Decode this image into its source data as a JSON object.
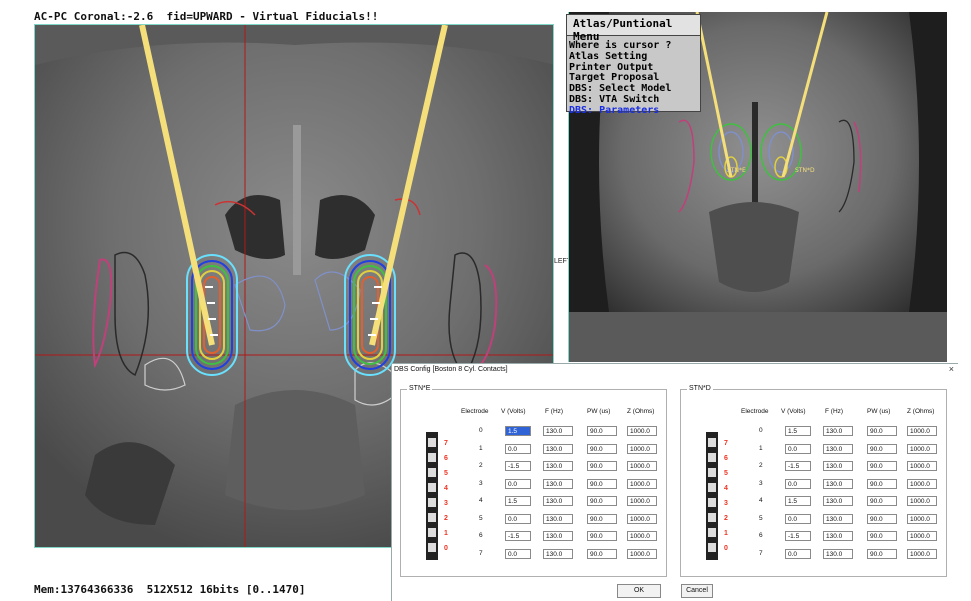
{
  "left_viewer": {
    "title": "AC-PC Coronal:-2.6  fid=UPWARD - Virtual Fiducials!!",
    "status": "Mem:13764366336  512X512 16bits [0..1470]",
    "side_label": "LEFT"
  },
  "atlas_menu": {
    "title": "Atlas/Puntional Menu",
    "items": [
      {
        "label": "Where is cursor ?",
        "active": false
      },
      {
        "label": "Atlas Setting",
        "active": false
      },
      {
        "label": "Printer Output",
        "active": false
      },
      {
        "label": "Target Proposal",
        "active": false
      },
      {
        "label": "DBS: Select Model",
        "active": false
      },
      {
        "label": "DBS: VTA Switch",
        "active": false
      },
      {
        "label": "DBS: Parameters",
        "active": true
      }
    ]
  },
  "right_viewer": {
    "label_left": "STN*E",
    "label_right": "STN*D"
  },
  "dbs_dialog": {
    "title": "DBS Config  [Boston 8 Cyl. Contacts]",
    "close": "×",
    "columns": [
      "Electrode",
      "V (Volts)",
      "F (Hz)",
      "PW (us)",
      "Z (Ohms)"
    ],
    "contact_labels": [
      "7",
      "6",
      "5",
      "4",
      "3",
      "2",
      "1",
      "0"
    ],
    "groups": [
      {
        "name": "STN*E",
        "rows": [
          {
            "electrode": "0",
            "v": "1.5",
            "f": "130.0",
            "pw": "90.0",
            "z": "1000.0"
          },
          {
            "electrode": "1",
            "v": "0.0",
            "f": "130.0",
            "pw": "90.0",
            "z": "1000.0"
          },
          {
            "electrode": "2",
            "v": "-1.5",
            "f": "130.0",
            "pw": "90.0",
            "z": "1000.0"
          },
          {
            "electrode": "3",
            "v": "0.0",
            "f": "130.0",
            "pw": "90.0",
            "z": "1000.0"
          },
          {
            "electrode": "4",
            "v": "1.5",
            "f": "130.0",
            "pw": "90.0",
            "z": "1000.0"
          },
          {
            "electrode": "5",
            "v": "0.0",
            "f": "130.0",
            "pw": "90.0",
            "z": "1000.0"
          },
          {
            "electrode": "6",
            "v": "-1.5",
            "f": "130.0",
            "pw": "90.0",
            "z": "1000.0"
          },
          {
            "electrode": "7",
            "v": "0.0",
            "f": "130.0",
            "pw": "90.0",
            "z": "1000.0"
          }
        ]
      },
      {
        "name": "STN*D",
        "rows": [
          {
            "electrode": "0",
            "v": "1.5",
            "f": "130.0",
            "pw": "90.0",
            "z": "1000.0"
          },
          {
            "electrode": "1",
            "v": "0.0",
            "f": "130.0",
            "pw": "90.0",
            "z": "1000.0"
          },
          {
            "electrode": "2",
            "v": "-1.5",
            "f": "130.0",
            "pw": "90.0",
            "z": "1000.0"
          },
          {
            "electrode": "3",
            "v": "0.0",
            "f": "130.0",
            "pw": "90.0",
            "z": "1000.0"
          },
          {
            "electrode": "4",
            "v": "1.5",
            "f": "130.0",
            "pw": "90.0",
            "z": "1000.0"
          },
          {
            "electrode": "5",
            "v": "0.0",
            "f": "130.0",
            "pw": "90.0",
            "z": "1000.0"
          },
          {
            "electrode": "6",
            "v": "-1.5",
            "f": "130.0",
            "pw": "90.0",
            "z": "1000.0"
          },
          {
            "electrode": "7",
            "v": "0.0",
            "f": "130.0",
            "pw": "90.0",
            "z": "1000.0"
          }
        ]
      }
    ],
    "ok_label": "OK",
    "cancel_label": "Cancel"
  },
  "colors": {
    "lead": "#f4df7a",
    "crosshair": "#b01818",
    "viewer_border": "#7fd7c8",
    "menu_active": "#1a2ee0",
    "contact_number": "#e32222"
  }
}
